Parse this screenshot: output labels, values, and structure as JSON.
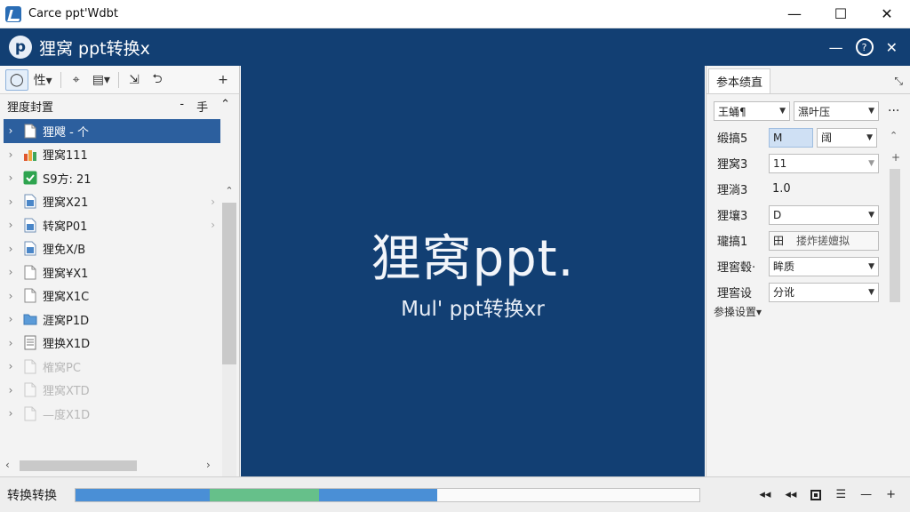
{
  "window": {
    "title": "Carce ppt'Wdbt",
    "controls": {
      "minimize": "—",
      "maximize": "☐",
      "close": "✕"
    }
  },
  "header": {
    "logo_glyph": "p",
    "title": "狸窝 ppt转换x",
    "controls": {
      "minimize": "—",
      "help": "?",
      "close": "✕"
    }
  },
  "left_panel": {
    "toolbar": [
      {
        "name": "lasso-tool",
        "glyph": "◯"
      },
      {
        "name": "property-dropdown",
        "label": "性▾"
      },
      {
        "name": "select-tool",
        "glyph": "⌖"
      },
      {
        "name": "layout-dropdown",
        "label": "▤▾"
      },
      {
        "name": "import-tool",
        "glyph": "⇲"
      },
      {
        "name": "return-tool",
        "glyph": "⮌"
      },
      {
        "name": "add-tool",
        "glyph": "+"
      }
    ],
    "header": {
      "title": "狸度封置",
      "mid": "-",
      "right": "手",
      "collapse": "⌃"
    },
    "tree": [
      {
        "label": "狸飕 - 个",
        "icon": "file",
        "selected": true,
        "faded": false,
        "rchev": false
      },
      {
        "label": "狸窝111",
        "icon": "chart",
        "selected": false,
        "faded": false,
        "rchev": false
      },
      {
        "label": "S9方: 21",
        "icon": "check",
        "selected": false,
        "faded": false,
        "rchev": false
      },
      {
        "label": "狸窝X21",
        "icon": "file-blue",
        "selected": false,
        "faded": false,
        "rchev": true
      },
      {
        "label": "转窝P01",
        "icon": "file-blue",
        "selected": false,
        "faded": false,
        "rchev": true
      },
      {
        "label": "狸免X/B",
        "icon": "file-blue",
        "selected": false,
        "faded": false,
        "rchev": false
      },
      {
        "label": "狸窝¥X1",
        "icon": "file",
        "selected": false,
        "faded": false,
        "rchev": false
      },
      {
        "label": "狸窝X1C",
        "icon": "file",
        "selected": false,
        "faded": false,
        "rchev": false
      },
      {
        "label": "涯窝P1D",
        "icon": "folder",
        "selected": false,
        "faded": false,
        "rchev": false
      },
      {
        "label": "狸换X1D",
        "icon": "doc",
        "selected": false,
        "faded": false,
        "rchev": false
      },
      {
        "label": "榷窝PC",
        "icon": "file",
        "selected": false,
        "faded": true,
        "rchev": false
      },
      {
        "label": "狸窝XTD",
        "icon": "file",
        "selected": false,
        "faded": true,
        "rchev": false
      },
      {
        "label": "—度X1D",
        "icon": "file",
        "selected": false,
        "faded": true,
        "rchev": false
      }
    ],
    "scroll": {
      "up": "⌃",
      "down": "⌄",
      "left": "‹",
      "right": "›"
    }
  },
  "center": {
    "title": "狸窝ppt.",
    "subtitle": "Mul' ppt转换xr"
  },
  "right_panel": {
    "tab": "参本绩直",
    "pin": "⤡",
    "top_dropdowns": [
      "王蛹¶",
      "濕叶压"
    ],
    "more": "···",
    "rows": [
      {
        "label": "缎搞5",
        "value": "M",
        "extra": "阔"
      },
      {
        "label": "狸窝3",
        "value": "11"
      },
      {
        "label": "理淌3",
        "value": "1.0"
      },
      {
        "label": "狸壤3",
        "value": "D"
      },
      {
        "label": "瓏搞1",
        "value": "田",
        "extra": "搂炸搓嬗拟"
      },
      {
        "label": "理窖毂·",
        "value": "眸质"
      },
      {
        "label": "理窖设",
        "value": "分讹"
      }
    ],
    "advanced": "参搡设置▾",
    "scroll": {
      "up": "⌃",
      "plus": "+"
    }
  },
  "status": {
    "label": "转换转换",
    "progress": [
      {
        "fraction": 0.215,
        "color": "#4a8fd6"
      },
      {
        "fraction": 0.175,
        "color": "#66c08a"
      },
      {
        "fraction": 0.19,
        "color": "#4a8fd6"
      }
    ],
    "controls": [
      "◂◂",
      "◂◂",
      "■",
      "☰",
      "—",
      "+"
    ]
  }
}
